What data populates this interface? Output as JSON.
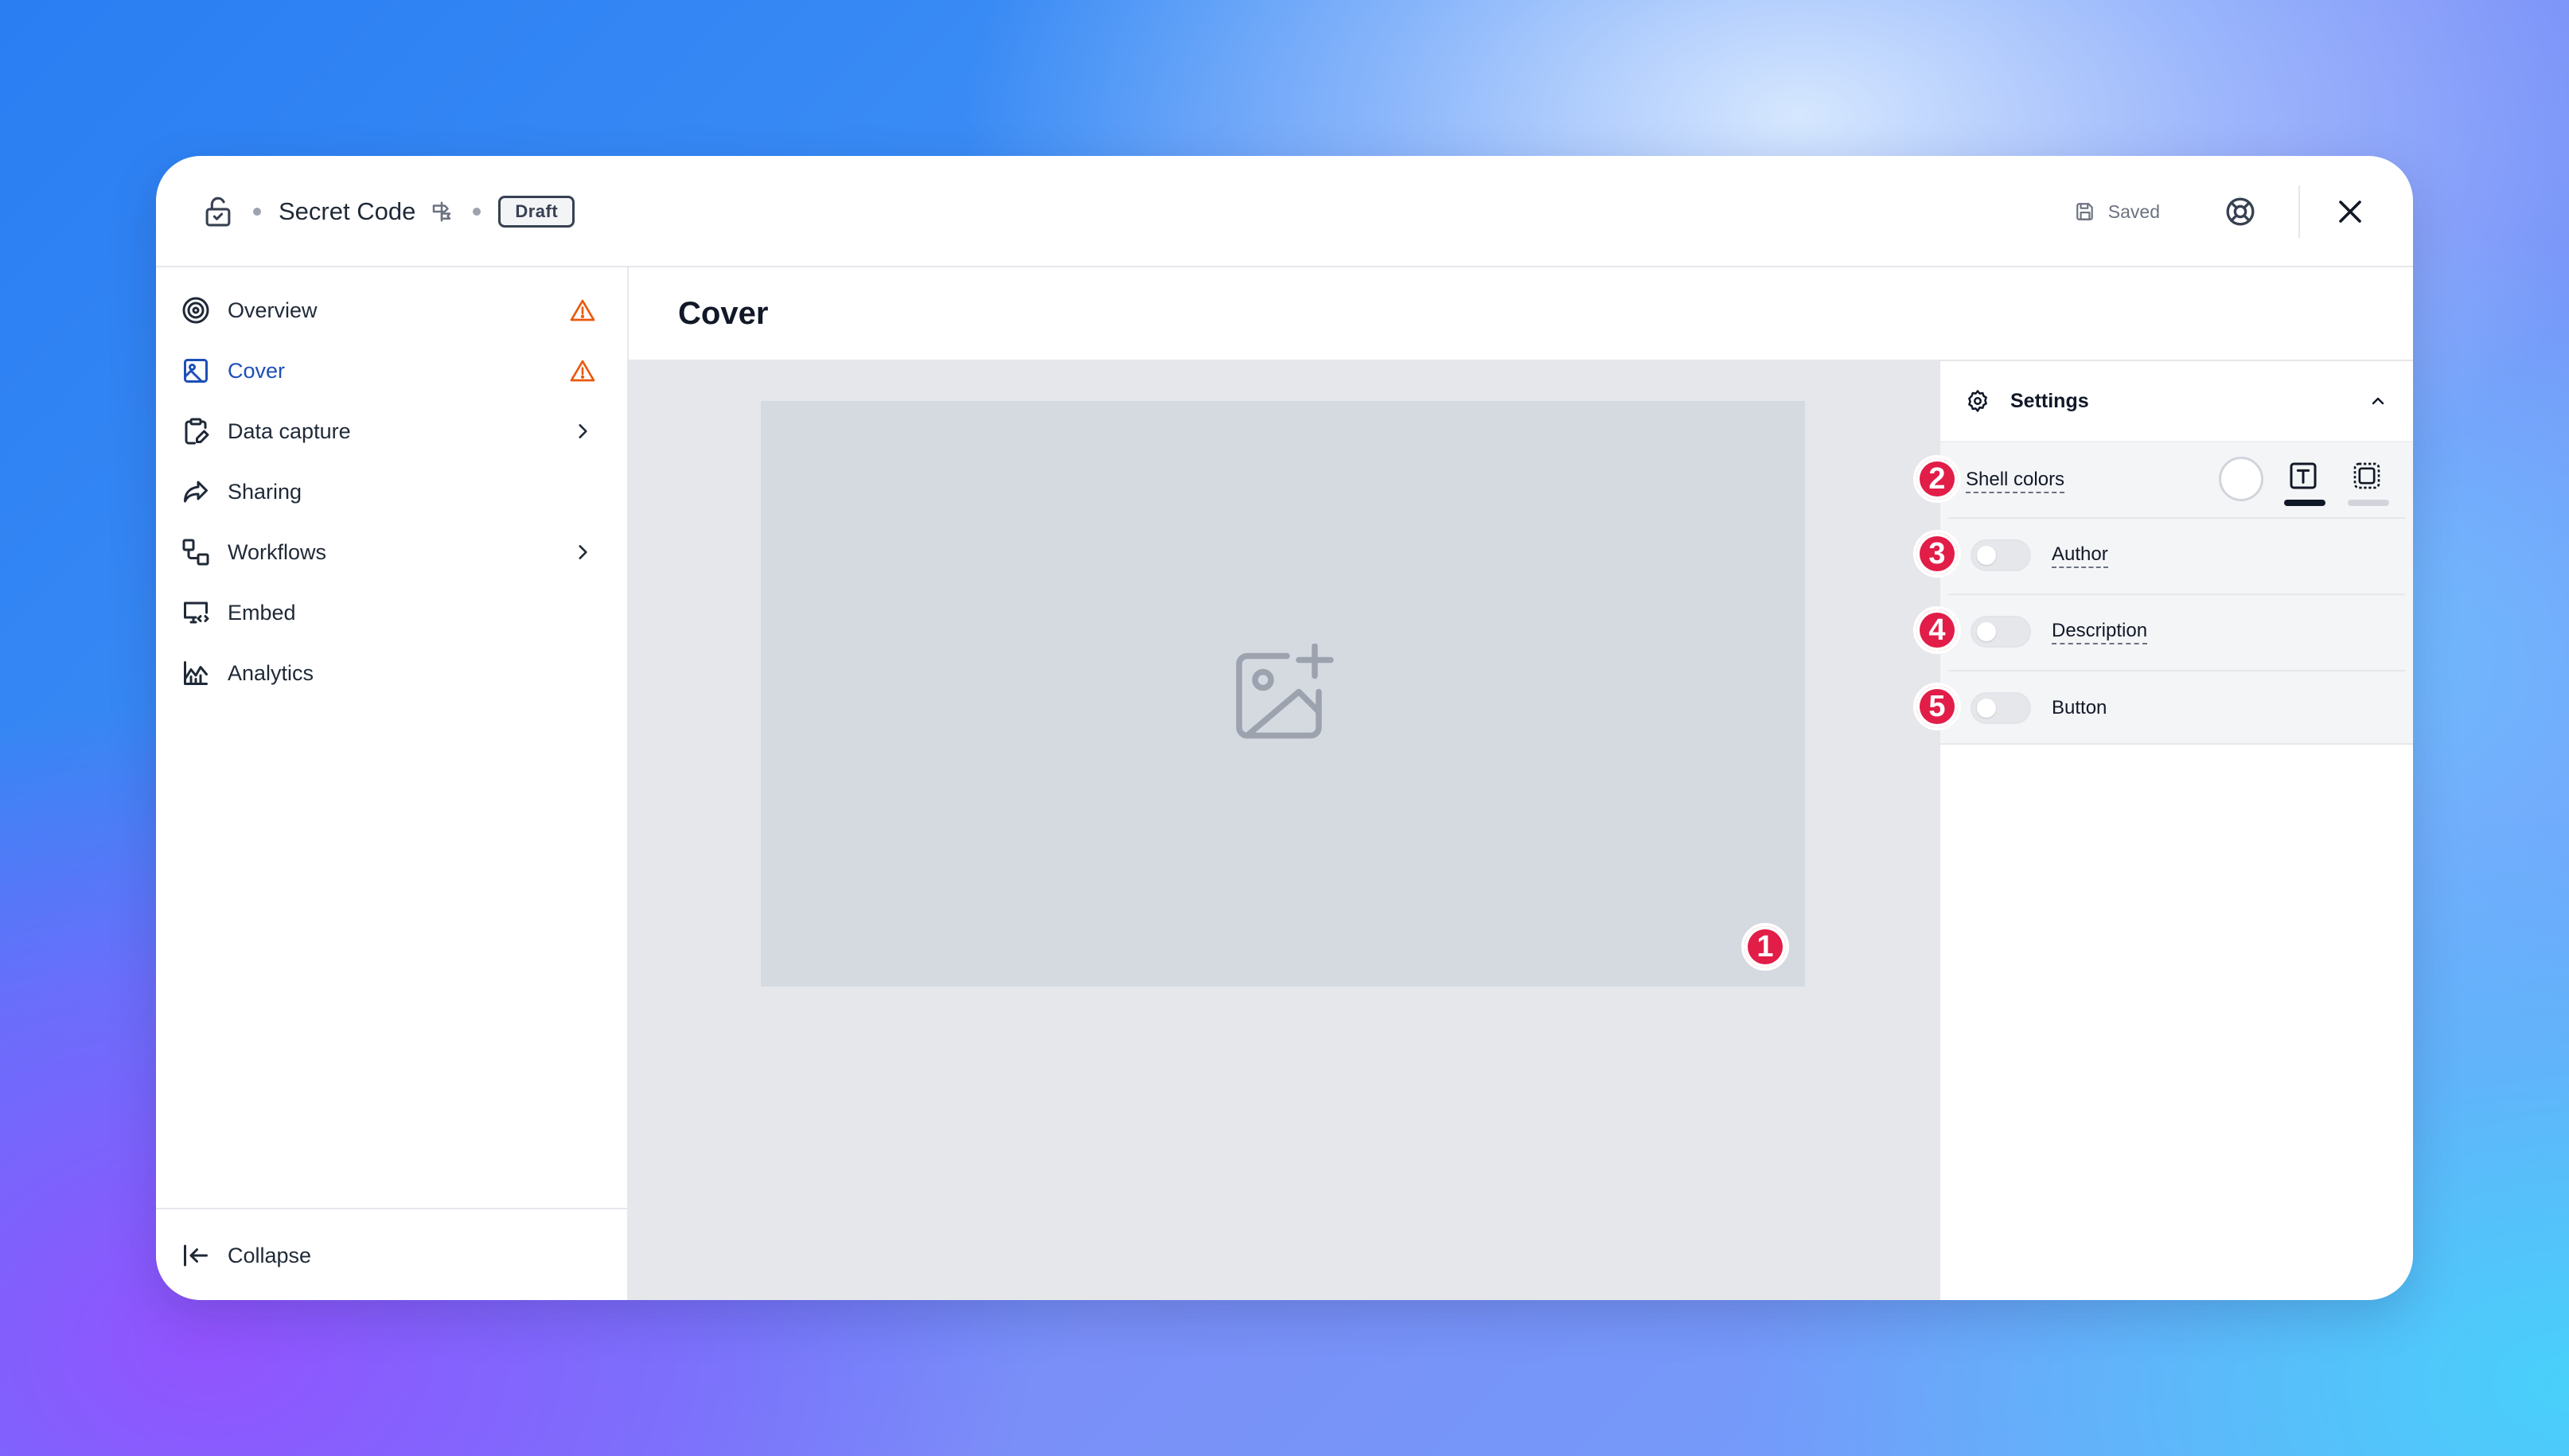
{
  "topbar": {
    "title": "Secret Code",
    "status_badge": "Draft",
    "saved_label": "Saved"
  },
  "sidebar": {
    "items": [
      {
        "label": "Overview",
        "icon": "target-icon",
        "trailing": "warning-icon"
      },
      {
        "label": "Cover",
        "icon": "image-icon",
        "trailing": "warning-icon",
        "active": true
      },
      {
        "label": "Data capture",
        "icon": "clipboard-edit-icon",
        "trailing": "chevron-right-icon"
      },
      {
        "label": "Sharing",
        "icon": "share-arrow-icon",
        "trailing": ""
      },
      {
        "label": "Workflows",
        "icon": "workflow-icon",
        "trailing": "chevron-right-icon"
      },
      {
        "label": "Embed",
        "icon": "monitor-code-icon",
        "trailing": ""
      },
      {
        "label": "Analytics",
        "icon": "chart-icon",
        "trailing": ""
      }
    ],
    "collapse_label": "Collapse"
  },
  "main": {
    "title": "Cover",
    "cover_marker": "1"
  },
  "settings": {
    "title": "Settings",
    "rows": [
      {
        "marker": "2",
        "label": "Shell colors"
      },
      {
        "marker": "3",
        "label": "Author",
        "enabled": false
      },
      {
        "marker": "4",
        "label": "Description",
        "enabled": false
      },
      {
        "marker": "5",
        "label": "Button",
        "enabled": false
      }
    ]
  },
  "colors": {
    "accent_active": "#1e4fb8",
    "warning": "#ea580c",
    "marker": "#e11d48"
  }
}
